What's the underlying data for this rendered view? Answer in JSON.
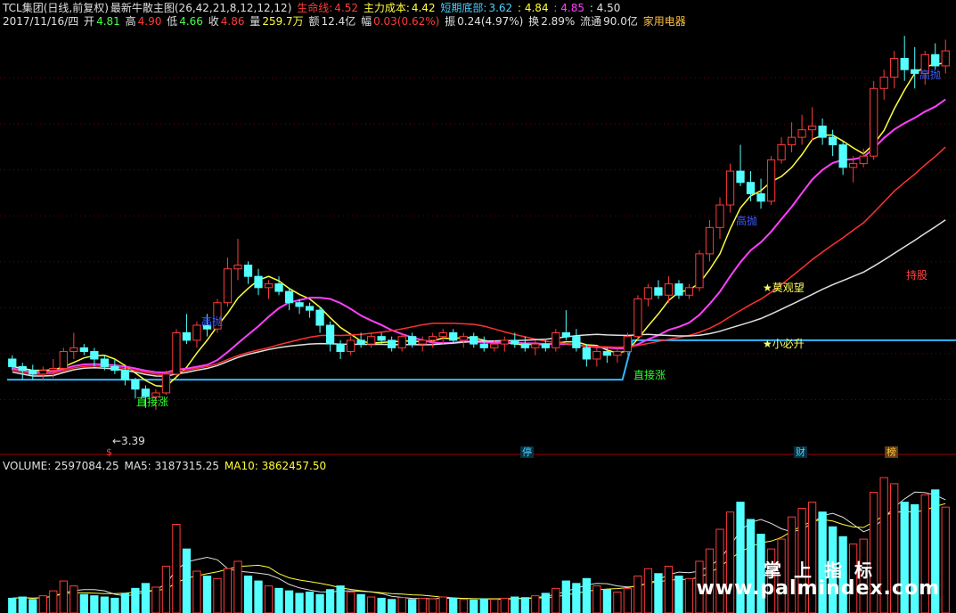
{
  "header": {
    "stock": "TCL集团(日线,前复权)",
    "indicator": "最新牛散主图(26,42,21,8,12,12,12)",
    "life_label": "生命线:",
    "life_value": "4.52",
    "cost_label": "主力成本:",
    "cost_value": "4.42",
    "bottom_label": "短期底部:",
    "bottom_value": "3.62",
    "v1": ": 4.84",
    "v2": ": 4.85",
    "v3": ": 4.50"
  },
  "quote": {
    "date": "2017/11/16/四",
    "open_label": "开",
    "open": "4.81",
    "high_label": "高",
    "high": "4.90",
    "low_label": "低",
    "low": "4.66",
    "close_label": "收",
    "close": "4.86",
    "vol_label": "量",
    "vol": "259.7万",
    "amt_label": "额",
    "amt": "12.4亿",
    "chg_label": "幅",
    "chg": "0.03(0.62%)",
    "amp_label": "振",
    "amp": "0.24(4.97%)",
    "turn_label": "换",
    "turn": "2.89%",
    "float_label": "流通",
    "float": "90.0亿",
    "sector": "家用电器"
  },
  "volume_header": {
    "vol": "VOLUME: 2597084.25",
    "ma5": "MA5: 3187315.25",
    "ma10": "MA10: 3862457.50"
  },
  "signals": {
    "sell1": "高抛",
    "sell2": "高抛",
    "sell3": "高抛",
    "buy1": "直接涨",
    "buy2": "直接涨",
    "watch": "★莫观望",
    "rise": "★小必升",
    "hold": "持股",
    "low_price": "←3.39"
  },
  "badges": {
    "b1": "$",
    "b2": "停",
    "b3": "财",
    "b4": "榜"
  },
  "watermark": {
    "cn": "掌上指标",
    "url": "www.palmindex.com"
  },
  "colors": {
    "up": "#ff3b3b",
    "down": "#54ffff",
    "ma_yellow": "#ffff3c",
    "ma_magenta": "#ff40ff",
    "ma_red": "#ff3030",
    "ma_white": "#e0e0e0",
    "support": "#30b8ff"
  },
  "chart_data": {
    "type": "candlestick",
    "price_range": [
      3.2,
      5.4
    ],
    "candles": [
      [
        3.66,
        3.68,
        3.6,
        3.62
      ],
      [
        3.62,
        3.64,
        3.55,
        3.6
      ],
      [
        3.6,
        3.63,
        3.55,
        3.58
      ],
      [
        3.58,
        3.62,
        3.55,
        3.6
      ],
      [
        3.6,
        3.66,
        3.56,
        3.61
      ],
      [
        3.61,
        3.72,
        3.6,
        3.7
      ],
      [
        3.7,
        3.8,
        3.66,
        3.72
      ],
      [
        3.72,
        3.74,
        3.68,
        3.7
      ],
      [
        3.7,
        3.72,
        3.62,
        3.66
      ],
      [
        3.66,
        3.68,
        3.6,
        3.62
      ],
      [
        3.62,
        3.66,
        3.58,
        3.6
      ],
      [
        3.6,
        3.62,
        3.52,
        3.55
      ],
      [
        3.55,
        3.56,
        3.45,
        3.5
      ],
      [
        3.5,
        3.52,
        3.4,
        3.46
      ],
      [
        3.46,
        3.5,
        3.39,
        3.48
      ],
      [
        3.48,
        3.6,
        3.47,
        3.58
      ],
      [
        3.58,
        3.82,
        3.57,
        3.8
      ],
      [
        3.8,
        3.9,
        3.74,
        3.76
      ],
      [
        3.76,
        3.86,
        3.72,
        3.84
      ],
      [
        3.84,
        3.9,
        3.78,
        3.82
      ],
      [
        3.82,
        3.98,
        3.8,
        3.96
      ],
      [
        3.96,
        4.2,
        3.94,
        4.14
      ],
      [
        4.14,
        4.3,
        4.08,
        4.16
      ],
      [
        4.16,
        4.18,
        4.06,
        4.1
      ],
      [
        4.1,
        4.14,
        4.0,
        4.04
      ],
      [
        4.04,
        4.08,
        3.98,
        4.06
      ],
      [
        4.06,
        4.1,
        4.0,
        4.02
      ],
      [
        4.02,
        4.04,
        3.92,
        3.96
      ],
      [
        3.96,
        3.98,
        3.9,
        3.94
      ],
      [
        3.94,
        3.96,
        3.88,
        3.92
      ],
      [
        3.92,
        3.94,
        3.8,
        3.84
      ],
      [
        3.84,
        3.86,
        3.7,
        3.74
      ],
      [
        3.74,
        3.76,
        3.66,
        3.7
      ],
      [
        3.7,
        3.78,
        3.68,
        3.76
      ],
      [
        3.76,
        3.8,
        3.72,
        3.74
      ],
      [
        3.74,
        3.8,
        3.72,
        3.78
      ],
      [
        3.78,
        3.8,
        3.74,
        3.76
      ],
      [
        3.76,
        3.78,
        3.7,
        3.72
      ],
      [
        3.72,
        3.8,
        3.7,
        3.78
      ],
      [
        3.78,
        3.8,
        3.72,
        3.74
      ],
      [
        3.74,
        3.78,
        3.7,
        3.76
      ],
      [
        3.76,
        3.8,
        3.72,
        3.78
      ],
      [
        3.78,
        3.82,
        3.74,
        3.8
      ],
      [
        3.8,
        3.82,
        3.74,
        3.76
      ],
      [
        3.76,
        3.8,
        3.72,
        3.78
      ],
      [
        3.78,
        3.8,
        3.72,
        3.74
      ],
      [
        3.74,
        3.78,
        3.7,
        3.72
      ],
      [
        3.72,
        3.76,
        3.7,
        3.74
      ],
      [
        3.74,
        3.78,
        3.7,
        3.76
      ],
      [
        3.76,
        3.8,
        3.72,
        3.74
      ],
      [
        3.74,
        3.78,
        3.7,
        3.72
      ],
      [
        3.72,
        3.76,
        3.68,
        3.74
      ],
      [
        3.74,
        3.76,
        3.7,
        3.72
      ],
      [
        3.72,
        3.82,
        3.7,
        3.8
      ],
      [
        3.8,
        3.92,
        3.76,
        3.78
      ],
      [
        3.78,
        3.82,
        3.7,
        3.72
      ],
      [
        3.72,
        3.74,
        3.62,
        3.66
      ],
      [
        3.66,
        3.72,
        3.62,
        3.7
      ],
      [
        3.7,
        3.72,
        3.64,
        3.68
      ],
      [
        3.68,
        3.72,
        3.64,
        3.7
      ],
      [
        3.7,
        3.8,
        3.68,
        3.78
      ],
      [
        3.78,
        4.0,
        3.76,
        3.98
      ],
      [
        3.98,
        4.06,
        3.94,
        4.04
      ],
      [
        4.04,
        4.08,
        3.98,
        4.0
      ],
      [
        4.0,
        4.1,
        3.96,
        4.06
      ],
      [
        4.06,
        4.08,
        3.98,
        4.0
      ],
      [
        4.0,
        4.06,
        3.98,
        4.04
      ],
      [
        4.04,
        4.24,
        4.02,
        4.22
      ],
      [
        4.22,
        4.4,
        4.18,
        4.36
      ],
      [
        4.36,
        4.52,
        4.3,
        4.48
      ],
      [
        4.48,
        4.7,
        4.44,
        4.66
      ],
      [
        4.66,
        4.8,
        4.58,
        4.6
      ],
      [
        4.6,
        4.66,
        4.5,
        4.54
      ],
      [
        4.54,
        4.62,
        4.46,
        4.5
      ],
      [
        4.5,
        4.74,
        4.48,
        4.72
      ],
      [
        4.72,
        4.84,
        4.7,
        4.8
      ],
      [
        4.8,
        4.92,
        4.76,
        4.84
      ],
      [
        4.84,
        4.96,
        4.8,
        4.88
      ],
      [
        4.88,
        5.0,
        4.82,
        4.9
      ],
      [
        4.9,
        4.94,
        4.8,
        4.84
      ],
      [
        4.84,
        4.88,
        4.74,
        4.8
      ],
      [
        4.8,
        4.82,
        4.64,
        4.68
      ],
      [
        4.68,
        4.74,
        4.6,
        4.7
      ],
      [
        4.7,
        4.78,
        4.68,
        4.74
      ],
      [
        4.74,
        5.14,
        4.72,
        5.1
      ],
      [
        5.1,
        5.2,
        5.04,
        5.16
      ],
      [
        5.16,
        5.3,
        5.1,
        5.26
      ],
      [
        5.26,
        5.38,
        5.14,
        5.2
      ],
      [
        5.2,
        5.32,
        5.1,
        5.18
      ],
      [
        5.18,
        5.3,
        5.12,
        5.28
      ],
      [
        5.28,
        5.34,
        5.2,
        5.22
      ],
      [
        5.22,
        5.36,
        5.18,
        5.3
      ]
    ],
    "volumes": [
      120,
      130,
      110,
      140,
      180,
      260,
      220,
      150,
      140,
      130,
      120,
      160,
      200,
      240,
      210,
      380,
      720,
      520,
      340,
      300,
      280,
      360,
      420,
      300,
      260,
      220,
      200,
      180,
      160,
      170,
      150,
      190,
      220,
      170,
      150,
      130,
      120,
      110,
      125,
      110,
      120,
      115,
      130,
      120,
      110,
      105,
      115,
      110,
      120,
      130,
      125,
      140,
      160,
      200,
      260,
      240,
      280,
      220,
      190,
      170,
      200,
      300,
      360,
      320,
      380,
      300,
      280,
      420,
      520,
      680,
      820,
      900,
      760,
      640,
      520,
      600,
      780,
      850,
      900,
      820,
      700,
      620,
      560,
      600,
      980,
      1100,
      1050,
      900,
      880,
      960,
      1000,
      860
    ],
    "support_levels": [
      3.55,
      3.55,
      3.76
    ]
  }
}
